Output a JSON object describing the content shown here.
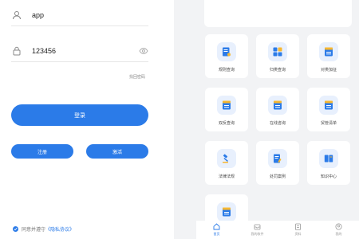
{
  "login": {
    "username_value": "app",
    "password_value": "123456",
    "forgot_label": "找回密码",
    "login_label": "登录",
    "register_label": "注册",
    "activate_label": "激活",
    "agree_prefix": "同意并遵守",
    "agree_link": "《隐私协议》"
  },
  "grid": {
    "items": [
      {
        "label": "规则查询",
        "icon": "document-search-icon"
      },
      {
        "label": "归类查询",
        "icon": "grid-icon"
      },
      {
        "label": "对类加征",
        "icon": "list-doc-icon"
      },
      {
        "label": "双反查询",
        "icon": "list-doc-icon"
      },
      {
        "label": "在线咨询",
        "icon": "list-doc-icon"
      },
      {
        "label": "贸管清单",
        "icon": "list-doc-icon"
      },
      {
        "label": "法律法规",
        "icon": "gavel-icon"
      },
      {
        "label": "处罚案例",
        "icon": "doc-pen-icon"
      },
      {
        "label": "知识中心",
        "icon": "book-icon"
      },
      {
        "label": "",
        "icon": "list-doc-icon"
      }
    ]
  },
  "tabbar": {
    "items": [
      {
        "label": "首页",
        "icon": "home-icon",
        "active": true
      },
      {
        "label": "我的收件",
        "icon": "inbox-icon",
        "active": false
      },
      {
        "label": "资料",
        "icon": "files-icon",
        "active": false
      },
      {
        "label": "我的",
        "icon": "user-icon",
        "active": false
      }
    ]
  },
  "colors": {
    "accent": "#2b7be8",
    "tile_icon_bg": "#e8f0fd",
    "background": "#f2f3f5"
  }
}
